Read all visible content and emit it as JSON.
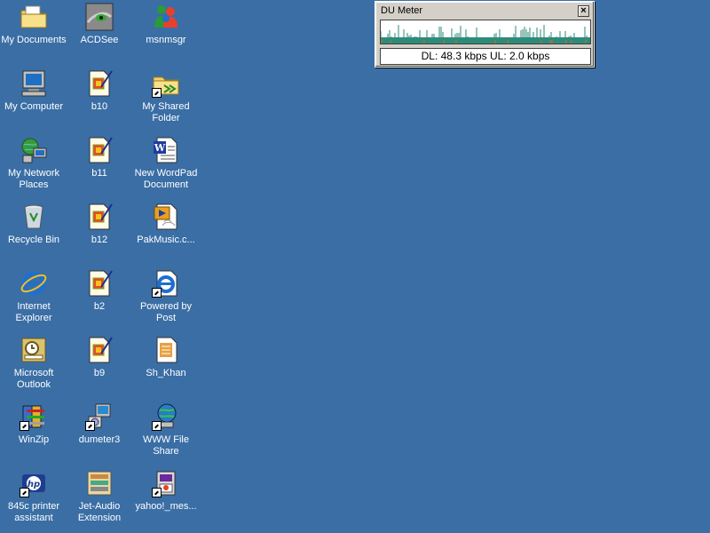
{
  "desktop": {
    "background": "#3a6ea5",
    "icons": [
      {
        "label": "My Documents",
        "icon": "folder-documents-icon"
      },
      {
        "label": "My Computer",
        "icon": "computer-icon"
      },
      {
        "label": "My Network Places",
        "icon": "network-places-icon"
      },
      {
        "label": "Recycle Bin",
        "icon": "recycle-bin-icon"
      },
      {
        "label": "Internet Explorer",
        "icon": "internet-explorer-icon"
      },
      {
        "label": "Microsoft Outlook",
        "icon": "outlook-icon"
      },
      {
        "label": "WinZip",
        "icon": "winzip-icon"
      },
      {
        "label": "845c printer assistant",
        "icon": "hp-printer-icon"
      },
      {
        "label": "ACDSee",
        "icon": "acdsee-icon"
      },
      {
        "label": "b10",
        "icon": "image-file-icon"
      },
      {
        "label": "b11",
        "icon": "image-file-icon"
      },
      {
        "label": "b12",
        "icon": "image-file-icon"
      },
      {
        "label": "b2",
        "icon": "image-file-icon"
      },
      {
        "label": "b9",
        "icon": "image-file-icon"
      },
      {
        "label": "dumeter3",
        "icon": "installer-icon"
      },
      {
        "label": "Jet-Audio Extension",
        "icon": "jetaudio-icon"
      },
      {
        "label": "msnmsgr",
        "icon": "msn-messenger-icon"
      },
      {
        "label": "My Shared Folder",
        "icon": "shared-folder-icon"
      },
      {
        "label": "New WordPad Document",
        "icon": "wordpad-document-icon"
      },
      {
        "label": "PakMusic.c...",
        "icon": "media-file-icon"
      },
      {
        "label": "Powered by Post",
        "icon": "ie-shortcut-icon"
      },
      {
        "label": "Sh_Khan",
        "icon": "text-document-icon"
      },
      {
        "label": "WWW File Share",
        "icon": "file-share-icon"
      },
      {
        "label": "yahoo!_mes...",
        "icon": "yahoo-messenger-icon"
      }
    ]
  },
  "du_meter": {
    "title": "DU Meter",
    "close_label": "×",
    "readout": "DL: 48.3 kbps  UL: 2.0 kbps",
    "colors": {
      "download": "#2e8b7a",
      "upload": "#d2691e"
    }
  }
}
